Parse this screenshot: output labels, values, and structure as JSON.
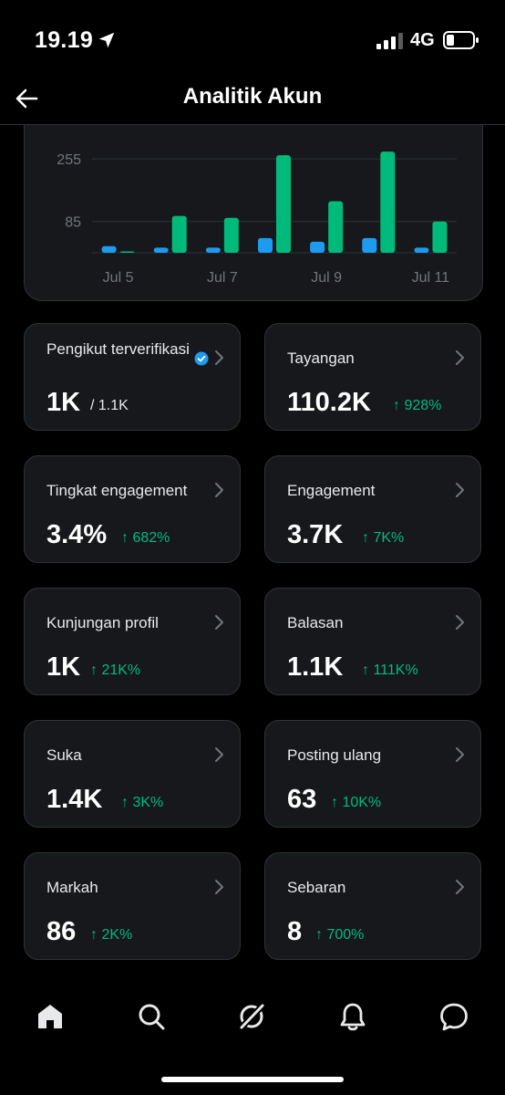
{
  "status_bar": {
    "time": "19.19",
    "network": "4G"
  },
  "header": {
    "title": "Analitik Akun"
  },
  "chart_data": {
    "type": "bar",
    "categories": [
      "Jul 5",
      "",
      "Jul 7",
      "",
      "Jul 9",
      "",
      "Jul 11"
    ],
    "x_tick_labels": [
      "Jul 5",
      "Jul 7",
      "Jul 9",
      "Jul 11"
    ],
    "y_tick_labels": [
      "255",
      "85"
    ],
    "ylim": [
      0,
      310
    ],
    "series": [
      {
        "color": "#1d9bf0",
        "values": [
          18,
          14,
          14,
          40,
          30,
          40,
          14
        ]
      },
      {
        "color": "#00ba7c",
        "values": [
          2,
          100,
          95,
          265,
          140,
          275,
          85
        ]
      }
    ]
  },
  "cards": [
    {
      "label": "Pengikut terverifikasi",
      "value": "1K",
      "sub": "/ 1.1K",
      "change": "",
      "verified": true
    },
    {
      "label": "Tayangan",
      "value": "110.2K",
      "sub": "",
      "change": "↑ 928%"
    },
    {
      "label": "Tingkat engagement",
      "value": "3.4%",
      "sub": "",
      "change": "↑ 682%"
    },
    {
      "label": "Engagement",
      "value": "3.7K",
      "sub": "",
      "change": "↑ 7K%"
    },
    {
      "label": "Kunjungan profil",
      "value": "1K",
      "sub": "",
      "change": "↑ 21K%"
    },
    {
      "label": "Balasan",
      "value": "1.1K",
      "sub": "",
      "change": "↑ 111K%"
    },
    {
      "label": "Suka",
      "value": "1.4K",
      "sub": "",
      "change": "↑ 3K%"
    },
    {
      "label": "Posting ulang",
      "value": "63",
      "sub": "",
      "change": "↑ 10K%"
    },
    {
      "label": "Markah",
      "value": "86",
      "sub": "",
      "change": "↑ 2K%"
    },
    {
      "label": "Sebaran",
      "value": "8",
      "sub": "",
      "change": "↑ 700%"
    }
  ],
  "nav": {
    "items": [
      "home-icon",
      "search-icon",
      "grok-icon",
      "notifications-icon",
      "messages-icon"
    ]
  },
  "colors": {
    "accent_green": "#00ba7c",
    "accent_blue": "#1d9bf0",
    "card_bg": "#16181c",
    "border": "#2f3336"
  }
}
